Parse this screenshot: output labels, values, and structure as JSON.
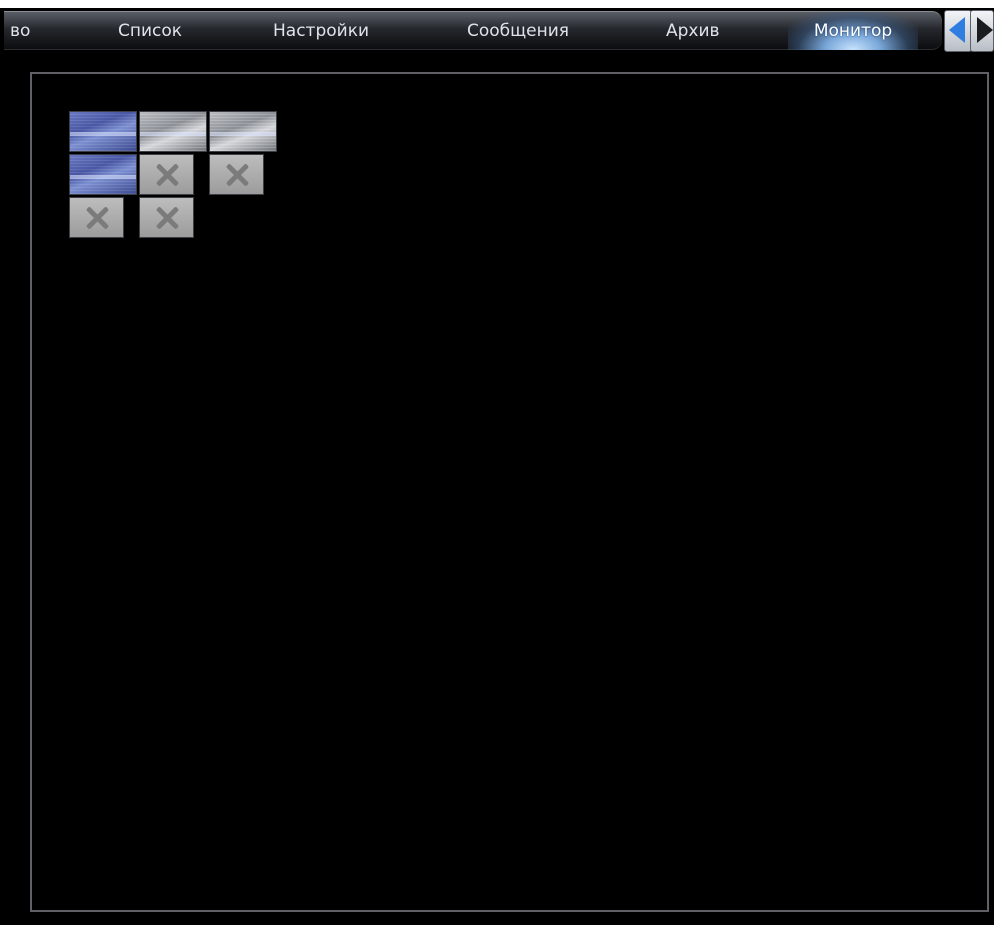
{
  "tabs": [
    {
      "label": "во",
      "active": false
    },
    {
      "label": "Список",
      "active": false
    },
    {
      "label": "Настройки",
      "active": false
    },
    {
      "label": "Сообщения",
      "active": false
    },
    {
      "label": "Архив",
      "active": false
    },
    {
      "label": "Монитор",
      "active": true
    }
  ],
  "nav": {
    "prev_icon": "arrow-left-icon",
    "next_icon": "arrow-right-icon",
    "prev_color": "#2f7de0"
  },
  "monitor": {
    "cameras": [
      {
        "state": "live",
        "tint": "blue"
      },
      {
        "state": "live",
        "tint": "gray"
      },
      {
        "state": "live",
        "tint": "gray"
      },
      {
        "state": "live",
        "tint": "blue"
      },
      {
        "state": "offline",
        "icon": "close-icon"
      },
      {
        "state": "offline",
        "icon": "close-icon"
      },
      {
        "state": "offline",
        "icon": "close-icon"
      },
      {
        "state": "offline",
        "icon": "close-icon"
      }
    ]
  }
}
